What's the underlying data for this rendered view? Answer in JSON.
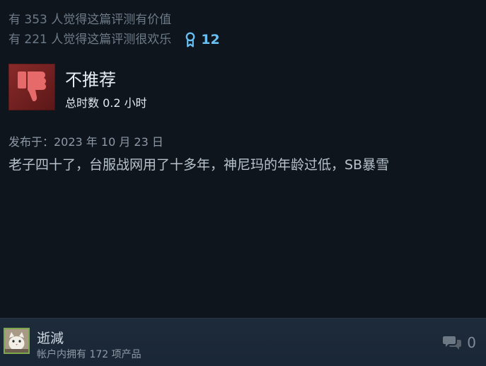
{
  "helpful": {
    "helpful_text": "有 353 人觉得这篇评测有价值",
    "funny_text": "有 221 人觉得这篇评测很欢乐",
    "award_count": "12"
  },
  "review": {
    "verdict": "不推荐",
    "playtime": "总时数 0.2 小时",
    "posted_date": "发布于：2023 年 10 月 23 日",
    "body": "老子四十了，台服战网用了十多年，神尼玛的年龄过低，SB暴雪"
  },
  "author": {
    "name": "逝減",
    "products_owned": "帐户内拥有 172 项产品"
  },
  "comments": {
    "count": "0"
  },
  "icons": {
    "award": "award-ribbon-icon",
    "thumb": "thumbs-down-icon",
    "comment": "comment-bubbles-icon"
  },
  "colors": {
    "accent": "#66c0f4",
    "not_recommended_bg": "#7a2222",
    "background": "#0f151d",
    "footer_background": "#1c2938"
  }
}
